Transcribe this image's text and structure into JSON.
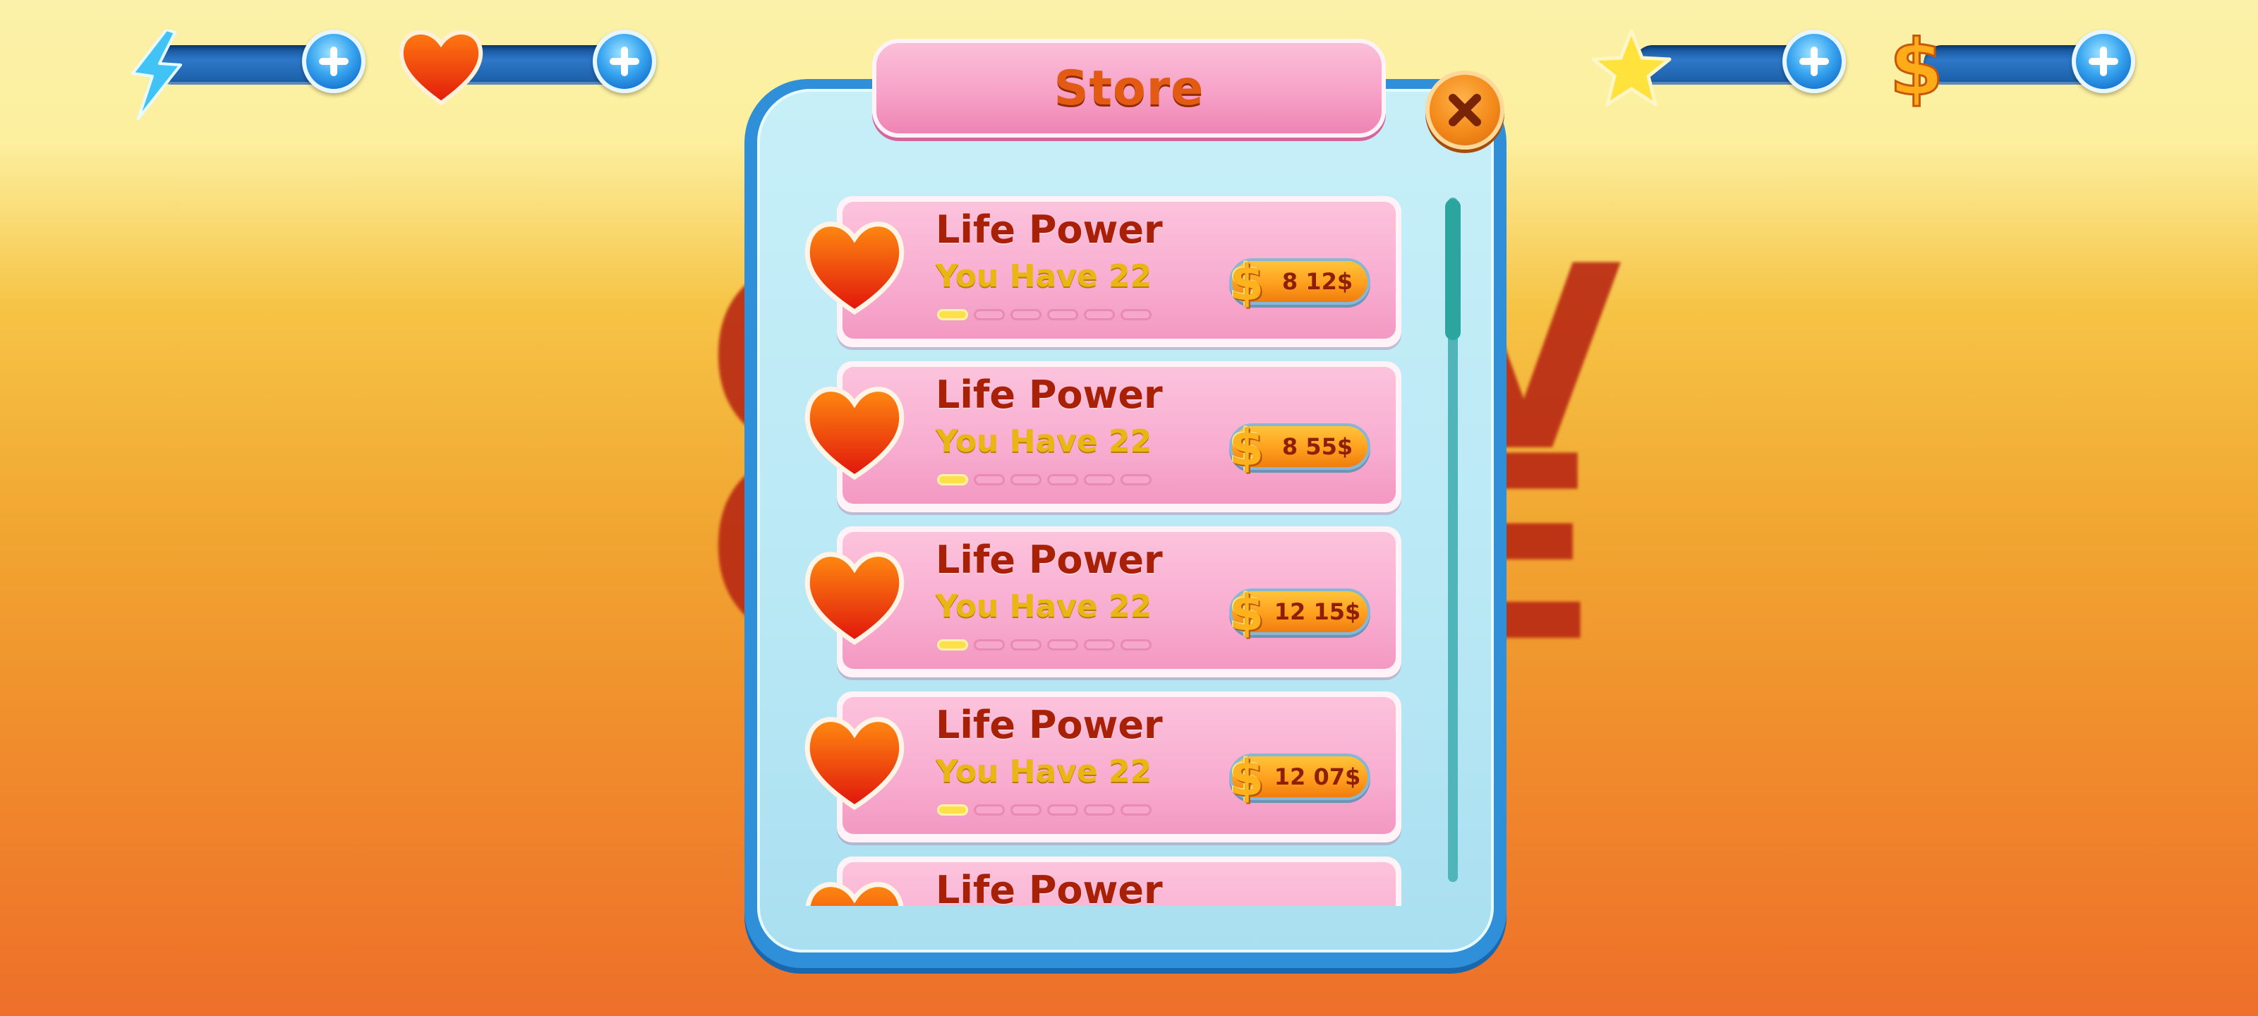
{
  "background_letters": [
    "G",
    "G",
    "V",
    "E"
  ],
  "hud": [
    {
      "icon": "lightning-icon",
      "plus_icon": "plus-icon"
    },
    {
      "icon": "heart-icon",
      "plus_icon": "plus-icon"
    },
    {
      "icon": "star-icon",
      "plus_icon": "plus-icon"
    },
    {
      "icon": "dollar-icon",
      "plus_icon": "plus-icon"
    }
  ],
  "store": {
    "title": "Store",
    "close_icon": "close-icon",
    "items": [
      {
        "title": "Life Power",
        "subtitle": "You Have 22",
        "price": "8 12$",
        "progress": "1/6"
      },
      {
        "title": "Life Power",
        "subtitle": "You Have 22",
        "price": "8 55$",
        "progress": "1/6"
      },
      {
        "title": "Life Power",
        "subtitle": "You Have 22",
        "price": "12 15$",
        "progress": "1/6"
      },
      {
        "title": "Life Power",
        "subtitle": "You Have 22",
        "price": "12 07$",
        "progress": "1/6"
      },
      {
        "title": "Life Power",
        "subtitle": "",
        "price": "",
        "progress": ""
      }
    ],
    "scroll_position": 0.0
  },
  "colors": {
    "accent_orange": "#e35a12",
    "panel_blue": "#2f8fd8",
    "item_pink": "#f8acd0",
    "title_red": "#a82006",
    "subtitle_gold": "#e9b614"
  }
}
